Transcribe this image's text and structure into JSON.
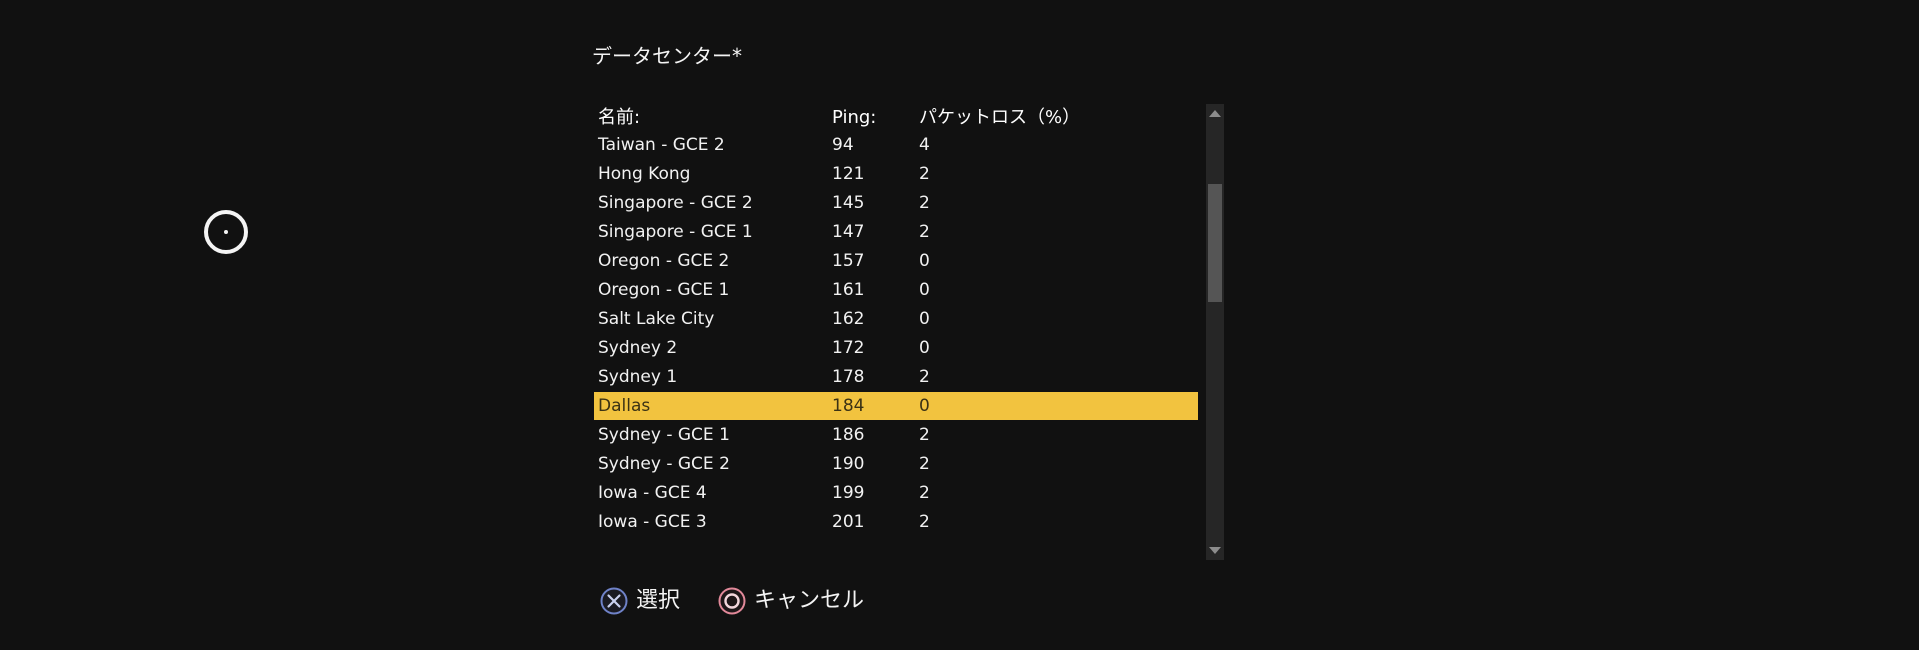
{
  "title": "データセンター*",
  "table": {
    "headers": {
      "name": "名前:",
      "ping": "Ping:",
      "loss": "パケットロス（%）"
    },
    "rows": [
      {
        "name": "Taiwan - GCE 2",
        "ping": "94",
        "loss": "4"
      },
      {
        "name": "Hong Kong",
        "ping": "121",
        "loss": "2"
      },
      {
        "name": "Singapore - GCE 2",
        "ping": "145",
        "loss": "2"
      },
      {
        "name": "Singapore - GCE 1",
        "ping": "147",
        "loss": "2"
      },
      {
        "name": "Oregon - GCE 2",
        "ping": "157",
        "loss": "0"
      },
      {
        "name": "Oregon - GCE 1",
        "ping": "161",
        "loss": "0"
      },
      {
        "name": "Salt Lake City",
        "ping": "162",
        "loss": "0"
      },
      {
        "name": "Sydney 2",
        "ping": "172",
        "loss": "0"
      },
      {
        "name": "Sydney 1",
        "ping": "178",
        "loss": "2"
      },
      {
        "name": "Dallas",
        "ping": "184",
        "loss": "0"
      },
      {
        "name": "Sydney - GCE 1",
        "ping": "186",
        "loss": "2"
      },
      {
        "name": "Sydney - GCE 2",
        "ping": "190",
        "loss": "2"
      },
      {
        "name": "Iowa - GCE 4",
        "ping": "199",
        "loss": "2"
      },
      {
        "name": "Iowa - GCE 3",
        "ping": "201",
        "loss": "2"
      }
    ],
    "selected_index": 9
  },
  "footer": {
    "select_label": "選択",
    "cancel_label": "キャンセル",
    "select_icon": "cross-button-icon",
    "cancel_icon": "circle-button-icon"
  },
  "colors": {
    "background": "#111111",
    "selected_row": "#f2c33f",
    "cross_button": "#6f82c8",
    "circle_button": "#e2899a"
  }
}
